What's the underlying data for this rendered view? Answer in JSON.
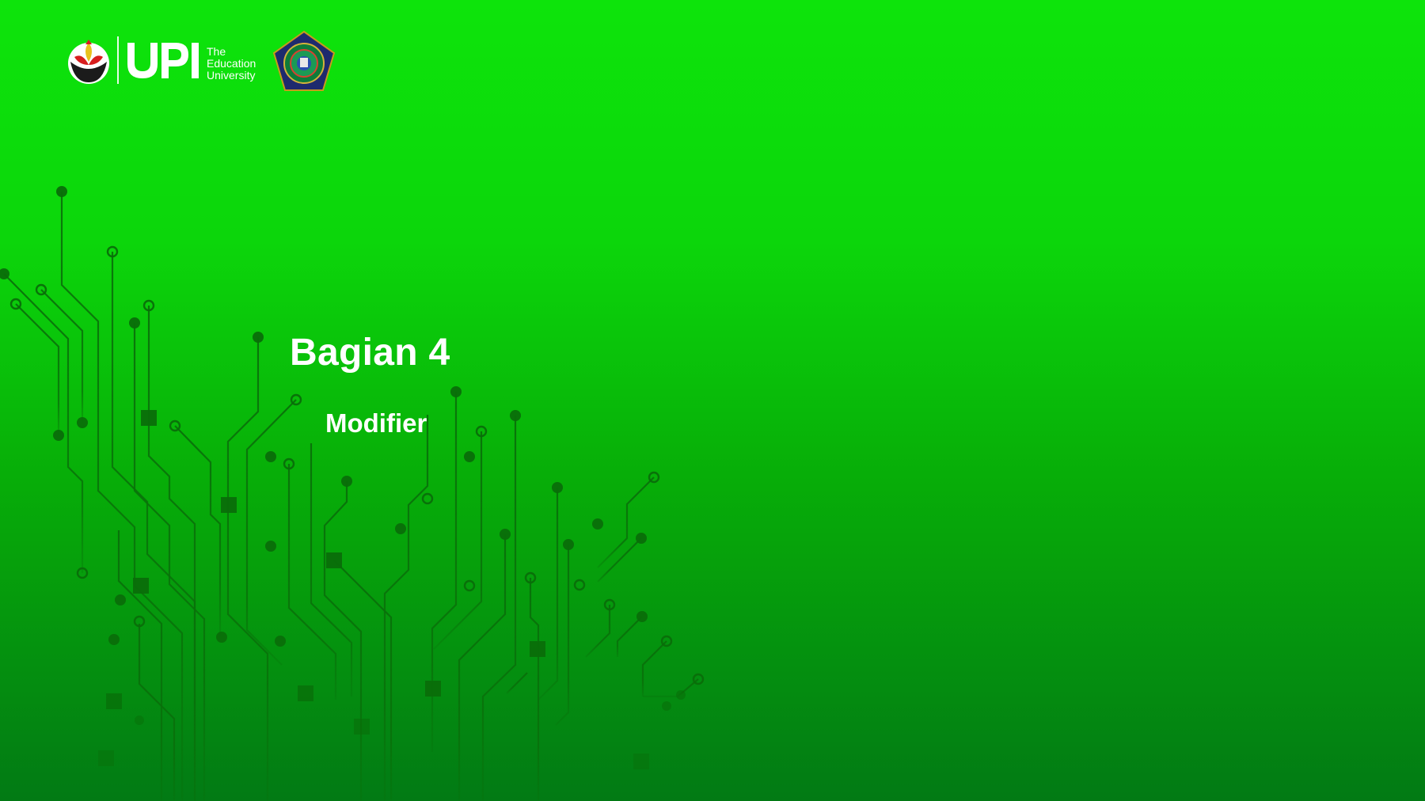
{
  "slide": {
    "title": "Bagian 4",
    "subtitle": "Modifier"
  },
  "logos": {
    "university_wordmark": "UPI",
    "university_tagline": "The Education University",
    "emblem_left": "upi-flower-emblem",
    "emblem_right": "institution-crest"
  },
  "theme": {
    "background_top": "#0de40b",
    "background_bottom": "#027a14",
    "circuit_color": "#0a6b0a",
    "text_color": "#ffffff"
  }
}
